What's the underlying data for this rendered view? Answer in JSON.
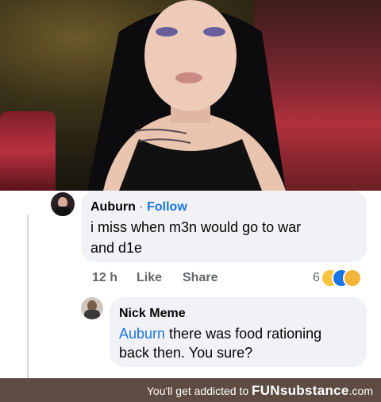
{
  "comment1": {
    "author": "Auburn",
    "separator": "·",
    "follow": "Follow",
    "text_line1": "i miss when m3n would go to war",
    "text_line2": "and d1e",
    "time": "12 h",
    "like": "Like",
    "share": "Share",
    "reaction_count": "6"
  },
  "comment2": {
    "author": "Nick Meme",
    "mention": "Auburn",
    "text_after_mention": " there was food rationing",
    "text_line2": "back then. You sure?"
  },
  "footer": {
    "tagline": "You'll get addicted to ",
    "brand": "FUNsubstance",
    "domain": ".com"
  },
  "colors": {
    "link_blue": "#1b74e4",
    "bubble_bg": "#f0f2f5",
    "footer_bg": "#5e4c43"
  }
}
